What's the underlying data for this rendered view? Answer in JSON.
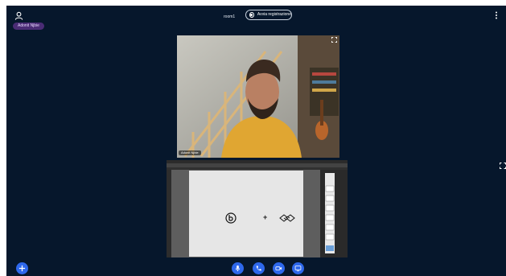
{
  "header": {
    "room_name": "room1",
    "recording_label": "Avvia registrazione"
  },
  "presenter": {
    "name": "Adonit Njbie"
  },
  "webcam": {
    "name_label": "Adonit Njbie"
  },
  "colors": {
    "background": "#06172c",
    "accent": "#2e68ec",
    "presenter_tag": "#4a2c75"
  },
  "icons": {
    "user": "user-icon",
    "record": "record-icon",
    "options": "vertical-dots-icon",
    "fullscreen": "fullscreen-icon",
    "add": "plus-icon",
    "mic": "microphone-icon",
    "phone": "phone-icon",
    "camera": "video-camera-icon",
    "screen": "screen-share-icon"
  }
}
